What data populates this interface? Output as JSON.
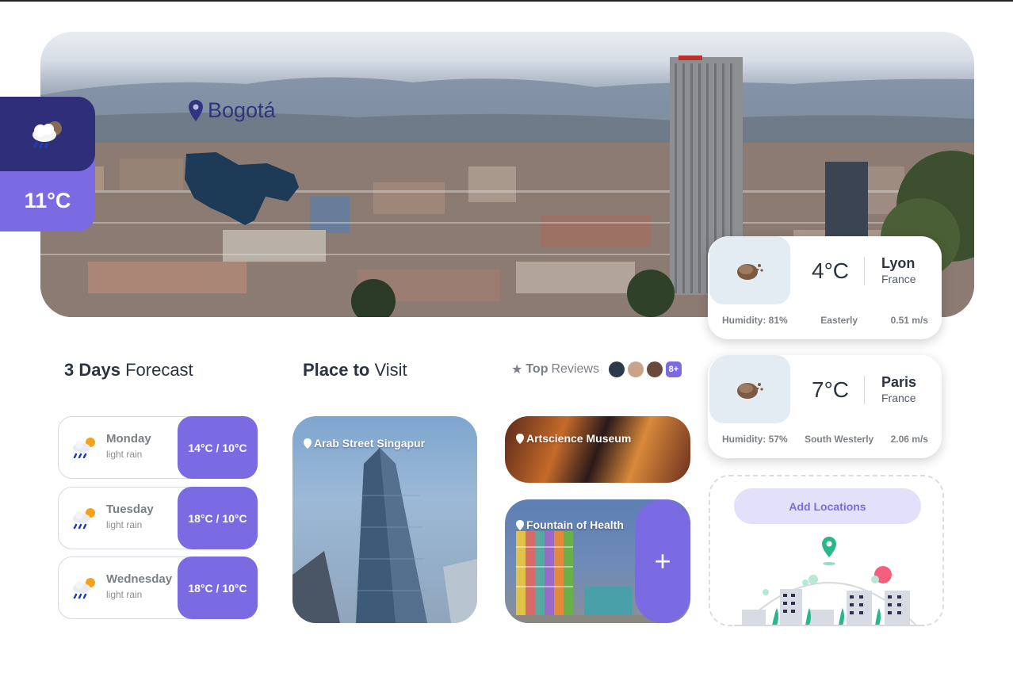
{
  "hero": {
    "city": "Bogotá",
    "current_temp": "11°C",
    "weather_icon": "rain-cloud-icon"
  },
  "forecast": {
    "title_bold": "3 Days",
    "title_rest": "Forecast",
    "days": [
      {
        "day": "Monday",
        "desc": "light rain",
        "range": "14°C / 10°C",
        "icon": "sun-rain-icon"
      },
      {
        "day": "Tuesday",
        "desc": "light rain",
        "range": "18°C / 10°C",
        "icon": "sun-rain-icon"
      },
      {
        "day": "Wednesday",
        "desc": "light rain",
        "range": "18°C / 10°C",
        "icon": "sun-rain-icon"
      }
    ]
  },
  "places": {
    "title_bold": "Place to",
    "title_rest": "Visit",
    "items": [
      {
        "name": "Arab Street Singapur"
      },
      {
        "name": "Artscience Museum"
      },
      {
        "name": "Fountain of Health"
      }
    ],
    "add_symbol": "+"
  },
  "reviews": {
    "star": "★",
    "bold": "Top",
    "rest": "Reviews",
    "more": "8+"
  },
  "cities": [
    {
      "temp": "4°C",
      "name": "Lyon",
      "country": "France",
      "humidity": "Humidity: 81%",
      "wind_dir": "Easterly",
      "wind_speed": "0.51 m/s",
      "icon": "cloud-icon"
    },
    {
      "temp": "7°C",
      "name": "Paris",
      "country": "France",
      "humidity": "Humidity: 57%",
      "wind_dir": "South Westerly",
      "wind_speed": "2.06 m/s",
      "icon": "cloud-icon"
    }
  ],
  "add_locations": {
    "label": "Add Locations"
  },
  "colors": {
    "accent": "#7b6be2",
    "dark_accent": "#2e2f78",
    "pin": "#2f3580"
  }
}
